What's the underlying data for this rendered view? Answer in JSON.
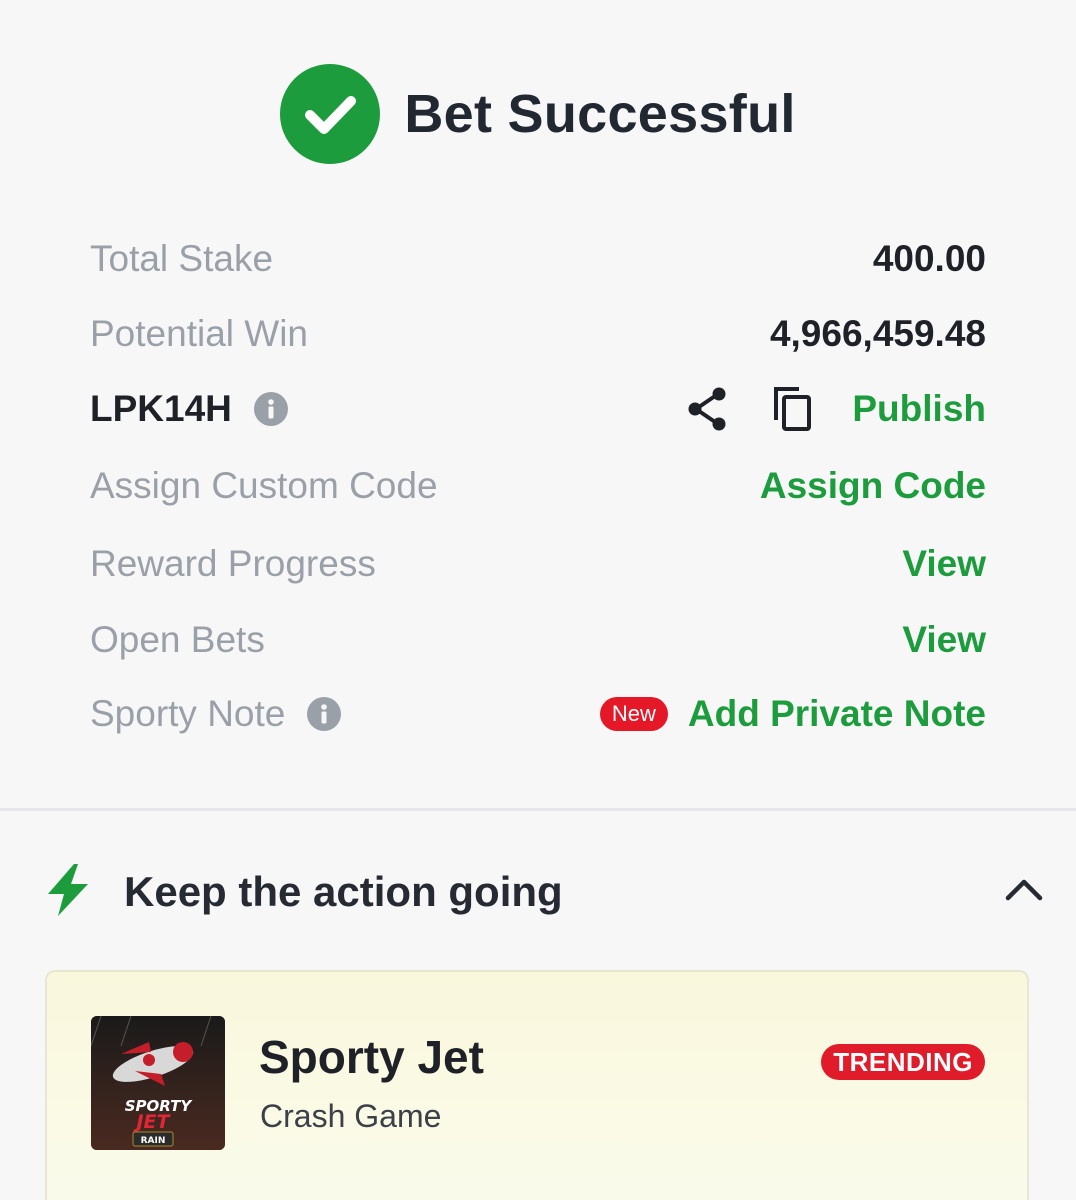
{
  "header": {
    "title": "Bet Successful",
    "icon": "check-circle-icon",
    "accent": "#1c9c3c"
  },
  "rows": {
    "total_stake": {
      "label": "Total Stake",
      "value": "400.00"
    },
    "potential_win": {
      "label": "Potential Win",
      "value": "4,966,459.48"
    },
    "booking_code": {
      "code": "LPK14H",
      "publish_label": "Publish"
    },
    "custom_code": {
      "label": "Assign Custom Code",
      "action": "Assign Code"
    },
    "reward_progress": {
      "label": "Reward Progress",
      "action": "View"
    },
    "open_bets": {
      "label": "Open Bets",
      "action": "View"
    },
    "sporty_note": {
      "label": "Sporty Note",
      "badge": "New",
      "action": "Add Private Note"
    }
  },
  "section": {
    "title": "Keep the action going",
    "icon": "lightning-icon"
  },
  "game": {
    "name": "Sporty Jet",
    "type": "Crash Game",
    "badge": "TRENDING",
    "thumb_text": "SPORTY JET",
    "thumb_sub": "RAIN"
  },
  "colors": {
    "green": "#1c9c3c",
    "red": "#e41827",
    "muted": "#9aa0a8",
    "text": "#1e2127"
  }
}
